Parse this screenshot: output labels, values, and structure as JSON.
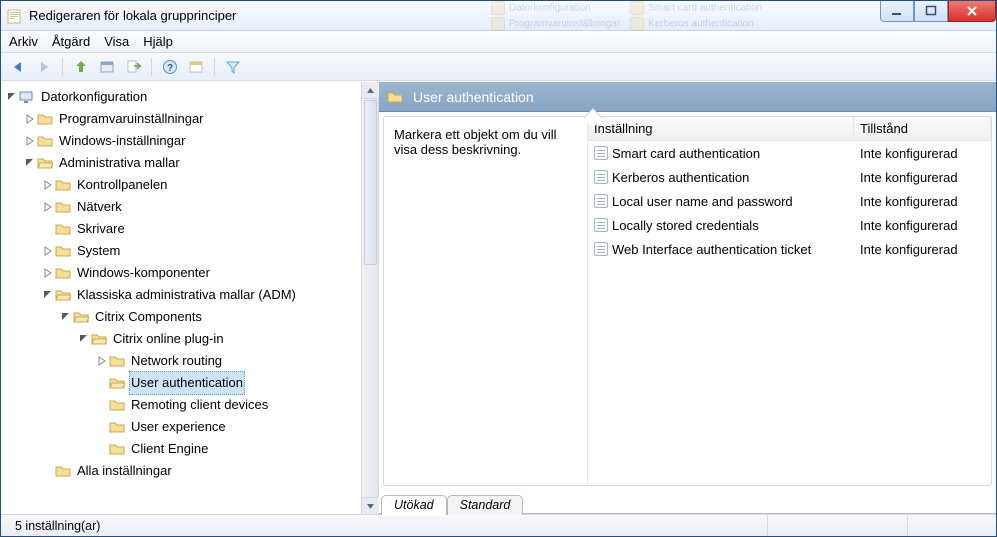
{
  "window": {
    "title": "Redigeraren för lokala grupprinciper"
  },
  "menu": {
    "arkiv": "Arkiv",
    "atgard": "Åtgärd",
    "visa": "Visa",
    "hjalp": "Hjälp"
  },
  "tree": {
    "root": {
      "label": "Datorkonfiguration"
    },
    "programvara": "Programvaruinställningar",
    "windows": "Windows-inställningar",
    "admin_mallar": "Administrativa mallar",
    "kontrollpanelen": "Kontrollpanelen",
    "natverk": "Nätverk",
    "skrivare": "Skrivare",
    "system": "System",
    "winkomp": "Windows-komponenter",
    "klassiska": "Klassiska administrativa mallar (ADM)",
    "citrix_comp": "Citrix Components",
    "citrix_plugin": "Citrix online plug-in",
    "net_routing": "Network routing",
    "user_auth": "User authentication",
    "remoting": "Remoting client devices",
    "user_exp": "User experience",
    "client_engine": "Client Engine",
    "alla": "Alla inställningar"
  },
  "right": {
    "header": "User authentication",
    "desc": "Markera ett objekt om du vill visa dess beskrivning.",
    "col_setting": "Inställning",
    "col_state": "Tillstånd",
    "rows": [
      {
        "name": "Smart card authentication",
        "state": "Inte konfigurerad"
      },
      {
        "name": "Kerberos authentication",
        "state": "Inte konfigurerad"
      },
      {
        "name": "Local user name and password",
        "state": "Inte konfigurerad"
      },
      {
        "name": "Locally stored credentials",
        "state": "Inte konfigurerad"
      },
      {
        "name": "Web Interface authentication ticket",
        "state": "Inte konfigurerad"
      }
    ],
    "tab_extended": "Utökad",
    "tab_standard": "Standard"
  },
  "status": {
    "text": "5 inställning(ar)"
  }
}
